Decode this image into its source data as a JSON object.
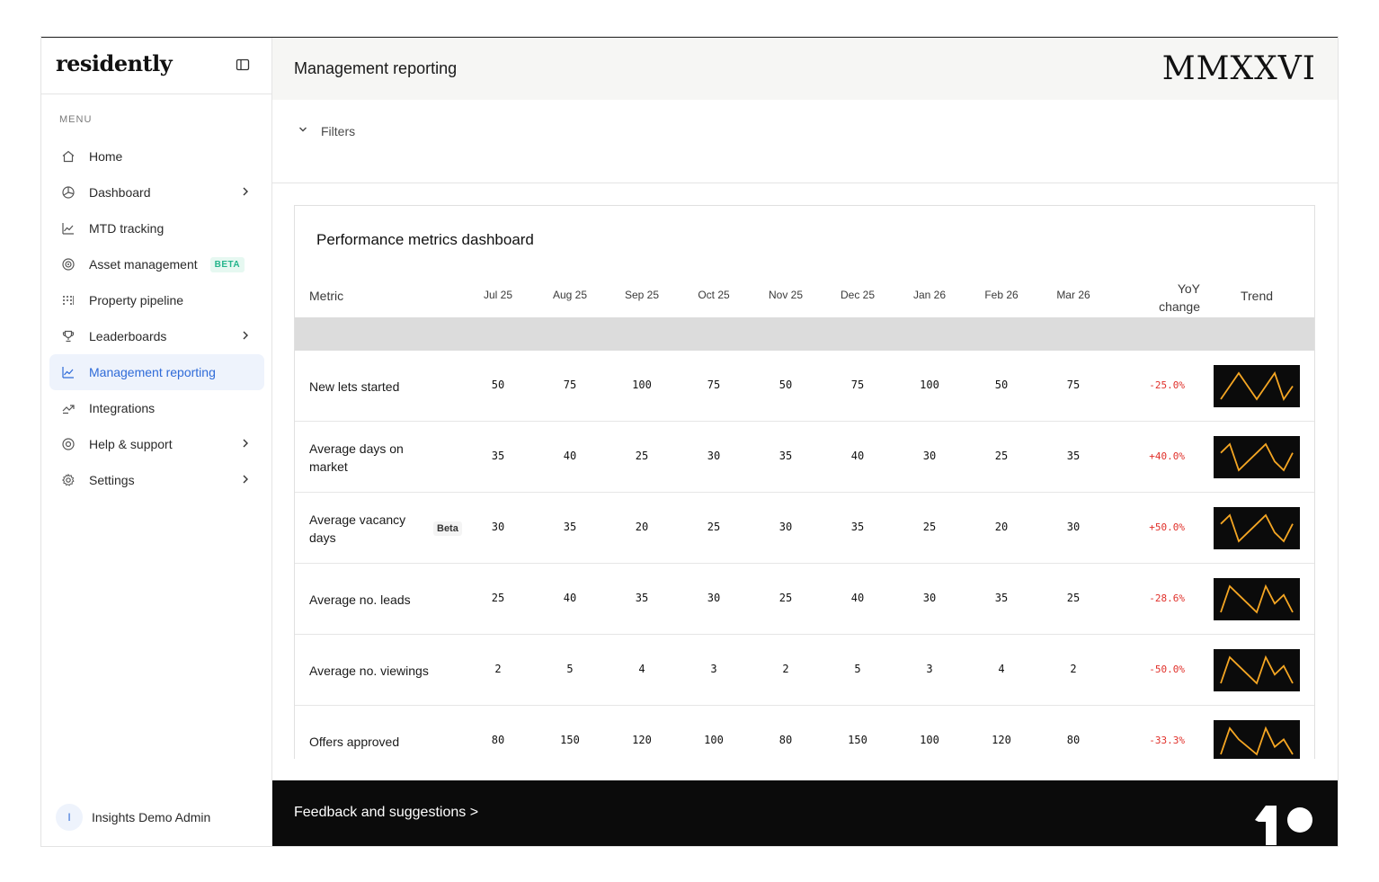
{
  "sidebar": {
    "logo": "residently",
    "menu_label": "MENU",
    "items": [
      {
        "label": "Home",
        "icon": "home-icon",
        "chevron": false
      },
      {
        "label": "Dashboard",
        "icon": "dashboard-icon",
        "chevron": true
      },
      {
        "label": "MTD tracking",
        "icon": "chart-line-icon",
        "chevron": false
      },
      {
        "label": "Asset management",
        "icon": "target-icon",
        "chevron": false,
        "badge": "BETA"
      },
      {
        "label": "Property pipeline",
        "icon": "pipeline-icon",
        "chevron": false
      },
      {
        "label": "Leaderboards",
        "icon": "trophy-icon",
        "chevron": true
      },
      {
        "label": "Management reporting",
        "icon": "report-chart-icon",
        "chevron": false,
        "active": true
      },
      {
        "label": "Integrations",
        "icon": "integrations-icon",
        "chevron": false
      },
      {
        "label": "Help & support",
        "icon": "help-icon",
        "chevron": true
      },
      {
        "label": "Settings",
        "icon": "gear-icon",
        "chevron": true
      }
    ],
    "user": {
      "initial": "I",
      "name": "Insights Demo Admin"
    }
  },
  "header": {
    "title": "Management reporting",
    "brand_mark": "MMXXVI"
  },
  "filters": {
    "label": "Filters"
  },
  "table": {
    "title": "Performance metrics dashboard",
    "metric_header": "Metric",
    "months": [
      "Jul 25",
      "Aug 25",
      "Sep 25",
      "Oct 25",
      "Nov 25",
      "Dec 25",
      "Jan 26",
      "Feb 26",
      "Mar 26"
    ],
    "yoy_header_line1": "YoY",
    "yoy_header_line2": "change",
    "trend_header": "Trend",
    "rows": [
      {
        "metric": "New lets started",
        "values": [
          "50",
          "75",
          "100",
          "75",
          "50",
          "75",
          "100",
          "50",
          "75"
        ],
        "yoy": "-25.0%"
      },
      {
        "metric": "Average days on market",
        "values": [
          "35",
          "40",
          "25",
          "30",
          "35",
          "40",
          "30",
          "25",
          "35"
        ],
        "yoy": "+40.0%"
      },
      {
        "metric": "Average vacancy days",
        "badge": "Beta",
        "values": [
          "30",
          "35",
          "20",
          "25",
          "30",
          "35",
          "25",
          "20",
          "30"
        ],
        "yoy": "+50.0%"
      },
      {
        "metric": "Average no. leads",
        "values": [
          "25",
          "40",
          "35",
          "30",
          "25",
          "40",
          "30",
          "35",
          "25"
        ],
        "yoy": "-28.6%"
      },
      {
        "metric": "Average no. viewings",
        "values": [
          "2",
          "5",
          "4",
          "3",
          "2",
          "5",
          "3",
          "4",
          "2"
        ],
        "yoy": "-50.0%"
      },
      {
        "metric": "Offers approved",
        "values": [
          "80",
          "150",
          "120",
          "100",
          "80",
          "150",
          "100",
          "120",
          "80"
        ],
        "yoy": "-33.3%"
      }
    ]
  },
  "footer": {
    "label": "Feedback and suggestions >"
  },
  "colors": {
    "accent": "#2f6bd8",
    "active_bg": "#eef3fc",
    "beta_green": "#25b58c",
    "negative_red": "#e0302a",
    "spark_line": "#f5a623",
    "spark_bg": "#0b0b0b"
  }
}
